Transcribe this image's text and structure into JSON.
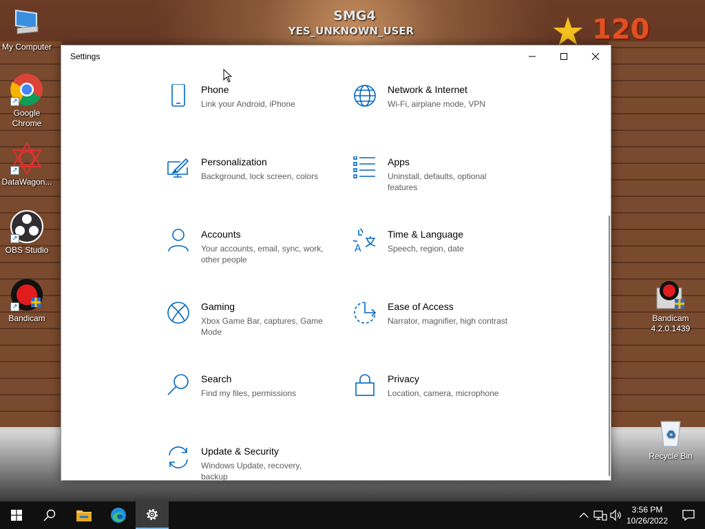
{
  "wallpaper": {
    "title": "SMG4",
    "subtitle": "YES_UNKNOWN_USER",
    "star_count": "120"
  },
  "desktop_icons": [
    {
      "label": "My Computer",
      "icon": "my-computer-icon"
    },
    {
      "label": "Google Chrome",
      "icon": "chrome-icon"
    },
    {
      "label": "DataWagon...",
      "icon": "datawagon-icon"
    },
    {
      "label": "OBS Studio",
      "icon": "obs-icon"
    },
    {
      "label": "Bandicam",
      "icon": "bandicam-icon"
    },
    {
      "label": "Bandicam 4.2.0.1439",
      "icon": "bandicam-installer-icon"
    },
    {
      "label": "Recycle Bin",
      "icon": "recycle-bin-icon"
    }
  ],
  "window": {
    "title": "Settings",
    "controls": {
      "minimize": "minimize-icon",
      "maximize": "maximize-icon",
      "close": "close-icon"
    }
  },
  "settings": {
    "accent_color": "#0067c0",
    "tiles": [
      {
        "name": "Phone",
        "desc": "Link your Android, iPhone",
        "icon": "phone-icon"
      },
      {
        "name": "Network & Internet",
        "desc": "Wi-Fi, airplane mode, VPN",
        "icon": "globe-icon"
      },
      {
        "name": "Personalization",
        "desc": "Background, lock screen, colors",
        "icon": "paintbrush-icon"
      },
      {
        "name": "Apps",
        "desc": "Uninstall, defaults, optional features",
        "icon": "apps-list-icon"
      },
      {
        "name": "Accounts",
        "desc": "Your accounts, email, sync, work, other people",
        "icon": "person-icon"
      },
      {
        "name": "Time & Language",
        "desc": "Speech, region, date",
        "icon": "time-language-icon"
      },
      {
        "name": "Gaming",
        "desc": "Xbox Game Bar, captures, Game Mode",
        "icon": "xbox-icon"
      },
      {
        "name": "Ease of Access",
        "desc": "Narrator, magnifier, high contrast",
        "icon": "ease-of-access-icon"
      },
      {
        "name": "Search",
        "desc": "Find my files, permissions",
        "icon": "search-icon"
      },
      {
        "name": "Privacy",
        "desc": "Location, camera, microphone",
        "icon": "lock-icon"
      },
      {
        "name": "Update & Security",
        "desc": "Windows Update, recovery, backup",
        "icon": "sync-icon"
      }
    ]
  },
  "taskbar": {
    "start": "windows-logo-icon",
    "search": "search-icon",
    "pinned": [
      "file-explorer-icon",
      "edge-icon",
      "settings-gear-icon"
    ],
    "tray": [
      "chevron-up-icon",
      "network-icon",
      "volume-icon"
    ],
    "time": "3:56 PM",
    "date": "10/26/2022",
    "notifications": "notification-icon"
  }
}
